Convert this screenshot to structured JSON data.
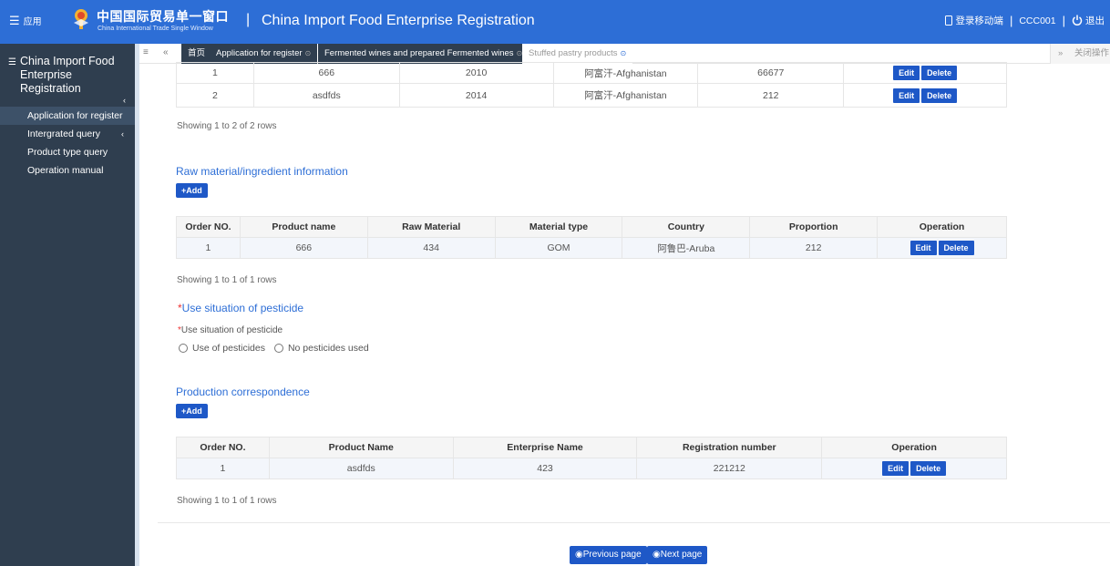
{
  "header": {
    "apps_label": "应用",
    "logo_cn": "中国国际贸易单一窗口",
    "logo_en": "China International Trade Single Window",
    "separator": "|",
    "title": "China Import Food Enterprise Registration",
    "mobile_label": "登录移动端",
    "bar1": "|",
    "user": "CCC001",
    "bar2": "|",
    "logout_label": "退出"
  },
  "sidebar": {
    "title": "China Import Food Enterprise Registration",
    "collapse": "‹",
    "items": [
      {
        "label": "Application for register",
        "active": true
      },
      {
        "label": "Intergrated query",
        "arrow": "‹"
      },
      {
        "label": "Product type query"
      },
      {
        "label": "Operation manual"
      }
    ]
  },
  "tabs": {
    "items": [
      {
        "label": "首页"
      },
      {
        "label": "Application for register",
        "close": "⊙"
      },
      {
        "label": "Fermented wines and prepared Fermented wines",
        "close": "⊙"
      },
      {
        "label": "Stuffed pastry products",
        "close": "⊙"
      }
    ],
    "right_label": "关闭操作"
  },
  "table1": {
    "rows": [
      [
        "1",
        "666",
        "2010",
        "阿富汗-Afghanistan",
        "66677"
      ],
      [
        "2",
        "asdfds",
        "2014",
        "阿富汗-Afghanistan",
        "212"
      ]
    ],
    "showing": "Showing 1 to 2 of 2 rows"
  },
  "raw_material": {
    "title": "Raw material/ingredient information",
    "add_label": "+Add",
    "headers": [
      "Order NO.",
      "Product name",
      "Raw Material",
      "Material type",
      "Country",
      "Proportion",
      "Operation"
    ],
    "rows": [
      [
        "1",
        "666",
        "434",
        "GOM",
        "阿鲁巴-Aruba",
        "212"
      ]
    ],
    "showing": "Showing 1 to 1 of 1 rows"
  },
  "pesticide": {
    "required_mark": "*",
    "title": "Use situation of pesticide",
    "field_label": "Use situation of pesticide",
    "options": [
      "Use of pesticides",
      "No pesticides used"
    ]
  },
  "production": {
    "title": "Production correspondence",
    "add_label": "+Add",
    "headers": [
      "Order NO.",
      "Product Name",
      "Enterprise Name",
      "Registration number",
      "Operation"
    ],
    "rows": [
      [
        "1",
        "asdfds",
        "423",
        "221212"
      ]
    ],
    "showing": "Showing 1 to 1 of 1 rows"
  },
  "buttons": {
    "edit": "Edit",
    "delete": "Delete",
    "prev": "Previous page",
    "next": "Next page",
    "prev_icon": "arrow-circle-left-icon",
    "next_icon": "arrow-circle-right-icon"
  },
  "colors": {
    "header_bg": "#2d6ed6",
    "sidebar_bg": "#2f3e4f",
    "button_bg": "#1e58c7",
    "accent_text": "#2d6ed6"
  }
}
